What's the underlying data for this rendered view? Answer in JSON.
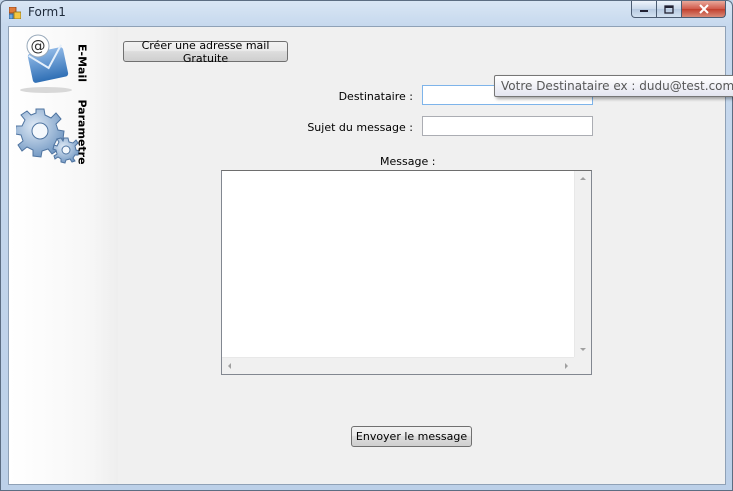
{
  "window": {
    "title": "Form1",
    "caption": {
      "minimize": "−",
      "maximize": "□",
      "close": "✕"
    }
  },
  "sidebar": {
    "items": [
      {
        "label": "E-Mail",
        "icon": "email-envelope-icon"
      },
      {
        "label": "Parametre",
        "icon": "gears-icon"
      }
    ]
  },
  "form": {
    "create_button": "Créer une adresse mail Gratuite",
    "destinataire_label": "Destinataire :",
    "destinataire_value": "",
    "sujet_label": "Sujet du message :",
    "sujet_value": "",
    "message_label": "Message :",
    "message_value": "",
    "send_button": "Envoyer le message"
  },
  "tooltip": {
    "text": "Votre Destinataire ex : dudu@test.com"
  },
  "colors": {
    "client_bg": "#f0f0f0",
    "focus_border": "#7eb4ea",
    "close_button": "#c13f2d"
  }
}
